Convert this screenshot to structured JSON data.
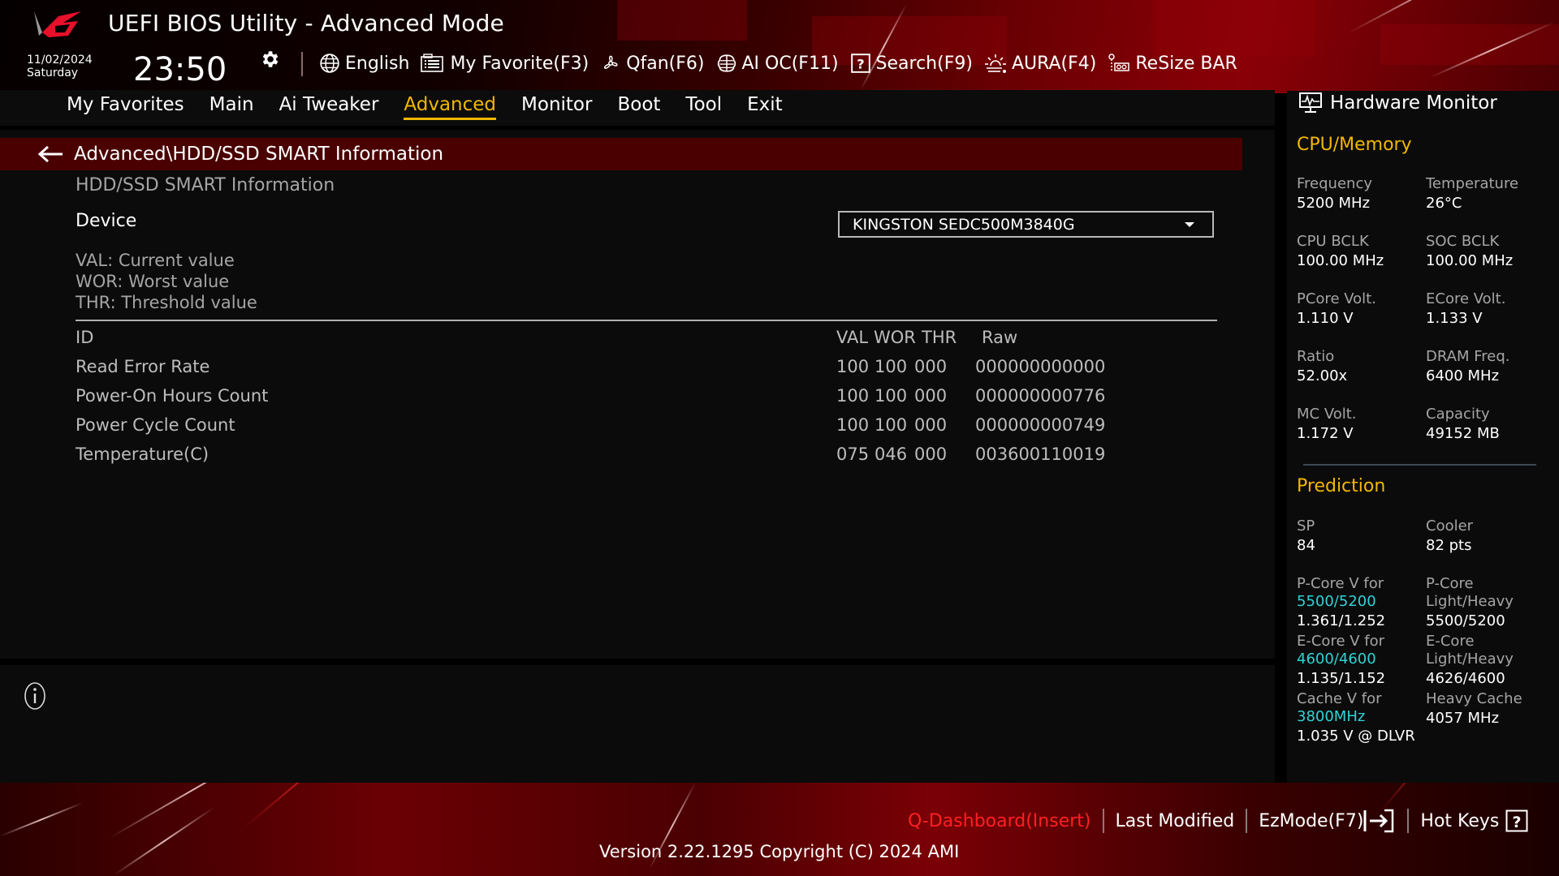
{
  "header": {
    "title": "UEFI BIOS Utility - Advanced Mode",
    "date": "11/02/2024",
    "day": "Saturday",
    "time": "23:50"
  },
  "toolbar": [
    {
      "icon": "globe-icon",
      "label": "English"
    },
    {
      "icon": "favorite-list-icon",
      "label": "My Favorite(F3)"
    },
    {
      "icon": "fan-icon",
      "label": "Qfan(F6)"
    },
    {
      "icon": "ai-brain-icon",
      "label": "AI OC(F11)"
    },
    {
      "icon": "search-question-icon",
      "label": "Search(F9)"
    },
    {
      "icon": "aura-light-icon",
      "label": "AURA(F4)"
    },
    {
      "icon": "resize-bar-icon",
      "label": "ReSize BAR"
    }
  ],
  "nav": {
    "tabs": [
      "My Favorites",
      "Main",
      "Ai Tweaker",
      "Advanced",
      "Monitor",
      "Boot",
      "Tool",
      "Exit"
    ],
    "active": "Advanced"
  },
  "breadcrumb": "Advanced\\HDD/SSD SMART Information",
  "content": {
    "section_title": "HDD/SSD SMART Information",
    "device_label": "Device",
    "device_value": "KINGSTON SEDC500M3840G",
    "legend": [
      "VAL:  Current value",
      "WOR: Worst value",
      "THR:  Threshold value"
    ],
    "table": {
      "headers": {
        "id": "ID",
        "val": "VAL",
        "wor": "WOR",
        "thr": "THR",
        "raw": "Raw"
      },
      "rows": [
        {
          "id": "Read Error Rate",
          "val": "100",
          "wor": "100",
          "thr": "000",
          "raw": "000000000000"
        },
        {
          "id": "Power-On Hours Count",
          "val": "100",
          "wor": "100",
          "thr": "000",
          "raw": "000000000776"
        },
        {
          "id": "Power Cycle Count",
          "val": "100",
          "wor": "100",
          "thr": "000",
          "raw": "000000000749"
        },
        {
          "id": "Temperature(C)",
          "val": "075",
          "wor": "046",
          "thr": "000",
          "raw": "003600110019"
        }
      ]
    }
  },
  "hardware_monitor": {
    "title": "Hardware Monitor",
    "cpu_memory": {
      "title": "CPU/Memory",
      "items": [
        {
          "label": "Frequency",
          "value": "5200 MHz"
        },
        {
          "label": "Temperature",
          "value": "26°C"
        },
        {
          "label": "CPU BCLK",
          "value": "100.00 MHz"
        },
        {
          "label": "SOC BCLK",
          "value": "100.00 MHz"
        },
        {
          "label": "PCore Volt.",
          "value": "1.110 V"
        },
        {
          "label": "ECore Volt.",
          "value": "1.133 V"
        },
        {
          "label": "Ratio",
          "value": "52.00x"
        },
        {
          "label": "DRAM Freq.",
          "value": "6400 MHz"
        },
        {
          "label": "MC Volt.",
          "value": "1.172 V"
        },
        {
          "label": "Capacity",
          "value": "49152 MB"
        }
      ]
    },
    "prediction": {
      "title": "Prediction",
      "sp_label": "SP",
      "sp_value": "84",
      "cooler_label": "Cooler",
      "cooler_value": "82 pts",
      "pcore_v_label": "P-Core V for",
      "pcore_v_freq": "5500/5200",
      "pcore_v_value": "1.361/1.252",
      "pcore_lh_label1": "P-Core",
      "pcore_lh_label2": "Light/Heavy",
      "pcore_lh_value": "5500/5200",
      "ecore_v_label": "E-Core V for",
      "ecore_v_freq": "4600/4600",
      "ecore_v_value": "1.135/1.152",
      "ecore_lh_label1": "E-Core",
      "ecore_lh_label2": "Light/Heavy",
      "ecore_lh_value": "4626/4600",
      "cache_v_label": "Cache V for",
      "cache_v_freq": "3800MHz",
      "cache_v_value": "1.035 V @ DLVR",
      "heavy_cache_label": "Heavy Cache",
      "heavy_cache_value": "4057 MHz"
    }
  },
  "footer": {
    "q_dashboard": "Q-Dashboard(Insert)",
    "last_modified": "Last Modified",
    "ezmode": "EzMode(F7)",
    "hotkeys": "Hot Keys",
    "version": "Version 2.22.1295 Copyright (C) 2024 AMI"
  },
  "colors": {
    "accent_yellow": "#f2b800",
    "breadcrumb_bg": "#4a0000",
    "highlight_cyan": "#2fd3d6",
    "q_dashboard_red": "#ff2020"
  }
}
